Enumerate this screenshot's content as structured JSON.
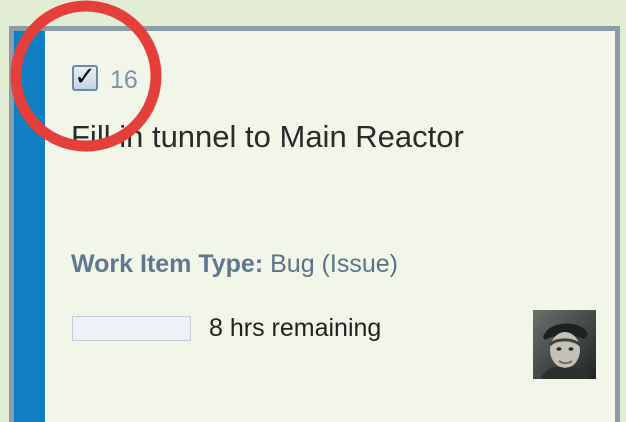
{
  "card": {
    "id": "16",
    "checkbox_checked": true,
    "title": "Fill in tunnel to Main Reactor",
    "work_item_type_label": "Work Item Type:",
    "work_item_type_value": "Bug (Issue)",
    "remaining_text": "8 hrs remaining",
    "progress_fraction": 0,
    "accent_color": "#0f7fc1",
    "background_color": "#f1f6e8"
  },
  "icons": {
    "checkbox": "checkmark",
    "avatar": "user-avatar",
    "annotation": "red-circle-highlight"
  },
  "colors": {
    "annotation": "#e53f3b",
    "page_background": "#e3edd3",
    "card_border": "#8a9da9"
  }
}
